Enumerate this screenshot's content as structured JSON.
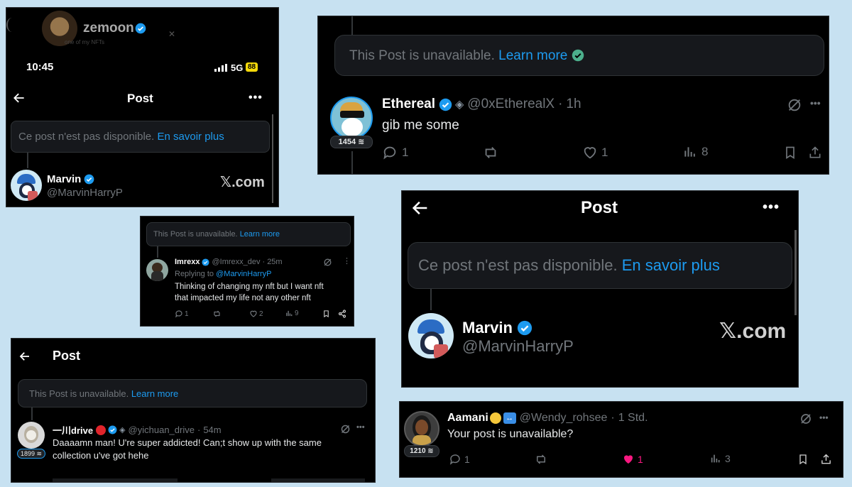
{
  "p1": {
    "header_name": "zemoon",
    "header_sub": "one of my NFTs",
    "time": "10:45",
    "network": "5G",
    "battery": "88",
    "title": "Post",
    "notice": "Ce post n'est pas disponible.",
    "learn_more": "En savoir plus",
    "name": "Marvin",
    "handle": "@MarvinHarryP",
    "brand": "𝕏.com"
  },
  "p2": {
    "notice": "This Post is unavailable.",
    "learn_more": "Learn more",
    "name": "Ethereal",
    "handle": "@0xEtherealX",
    "dot": "·",
    "time": "1h",
    "text": "gib me some",
    "pill": "1454",
    "replies": "1",
    "likes": "1",
    "views": "8"
  },
  "p3": {
    "notice": "This Post is unavailable.",
    "learn_more": "Learn more",
    "name": "Imrexx",
    "handle": "@Imrexx_dev",
    "dot": "·",
    "time": "25m",
    "replying": "Replying to",
    "reply_handle": "@MarvinHarryP",
    "text1": "Thinking of changing my nft but I want nft",
    "text2": "that impacted my life not any other nft",
    "replies": "1",
    "likes": "2",
    "views": "9"
  },
  "p4": {
    "title": "Post",
    "notice": "Ce post n'est pas disponible.",
    "learn_more": "En savoir plus",
    "name": "Marvin",
    "handle": "@MarvinHarryP",
    "brand": "𝕏.com"
  },
  "p5": {
    "title": "Post",
    "notice": "This Post is unavailable.",
    "learn_more": "Learn more",
    "name": "一川drive",
    "handle": "@yichuan_drive",
    "dot": "·",
    "time": "54m",
    "text1": "Daaaamn man! U're super addicted! Can;t show up with the same",
    "text2": "collection u've got hehe",
    "pill": "1899"
  },
  "p6": {
    "name": "Aamani",
    "handle": "@Wendy_rohsee",
    "dot": "·",
    "time": "1 Std.",
    "text": "Your post is unavailable?",
    "pill": "1210",
    "replies": "1",
    "likes": "1",
    "views": "3",
    "like_color": "#f91880"
  },
  "colors": {
    "background": "#c7e1f1",
    "panel": "#000000",
    "link": "#1d9bf0",
    "verified": "#1d9bf0",
    "muted": "#71767b"
  }
}
